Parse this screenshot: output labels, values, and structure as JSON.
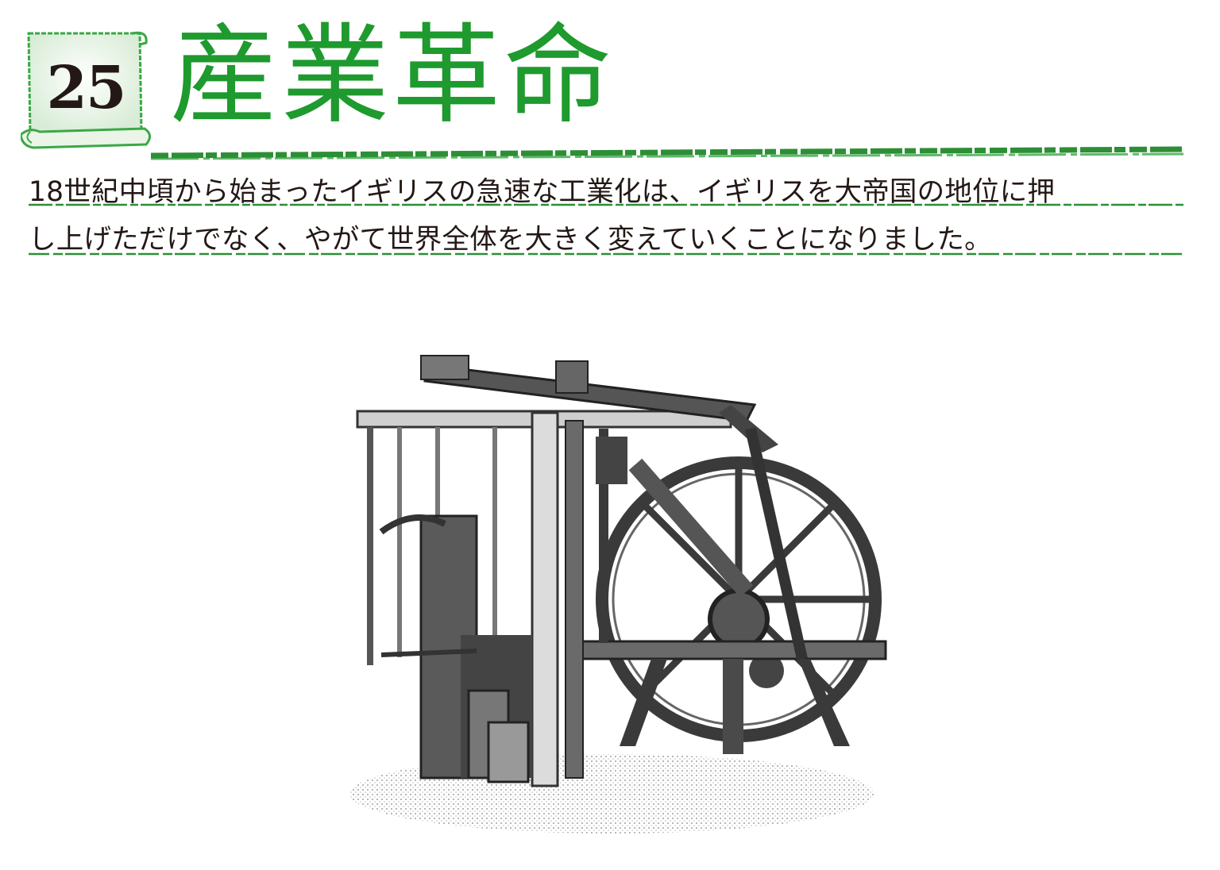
{
  "chapter": {
    "number": "25",
    "title": "産業革命"
  },
  "intro": {
    "lines": [
      "18世紀中頃から始まったイギリスの急速な工業化は、イギリスを大帝国の地位に押",
      "し上げただけでなく、やがて世界全体を大きく変えていくことになりました。"
    ]
  },
  "colors": {
    "accent": "#1e9a2e",
    "text": "#231815"
  },
  "illustration": {
    "subject": "steam-engine"
  }
}
